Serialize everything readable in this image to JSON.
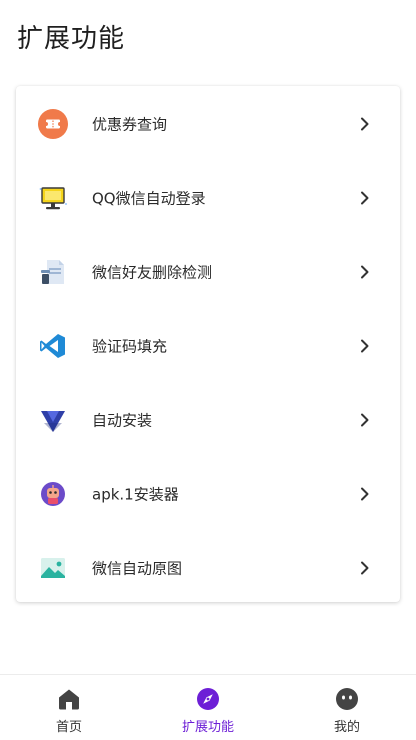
{
  "header": {
    "title": "扩展功能"
  },
  "features": [
    {
      "label": "优惠券查询",
      "icon": "coupon-icon"
    },
    {
      "label": "QQ微信自动登录",
      "icon": "computer-login-icon"
    },
    {
      "label": "微信好友删除检测",
      "icon": "document-check-icon"
    },
    {
      "label": "验证码填充",
      "icon": "vscode-icon"
    },
    {
      "label": "自动安装",
      "icon": "install-triangle-icon"
    },
    {
      "label": "apk.1安装器",
      "icon": "robot-icon"
    },
    {
      "label": "微信自动原图",
      "icon": "image-icon"
    }
  ],
  "bottom_nav": {
    "items": [
      {
        "label": "首页",
        "icon": "home-icon",
        "active": false
      },
      {
        "label": "扩展功能",
        "icon": "compass-icon",
        "active": true
      },
      {
        "label": "我的",
        "icon": "face-icon",
        "active": false
      }
    ]
  },
  "colors": {
    "accent": "#6d1fd6",
    "card_bg": "#ffffff",
    "text": "#2b2b2b"
  }
}
